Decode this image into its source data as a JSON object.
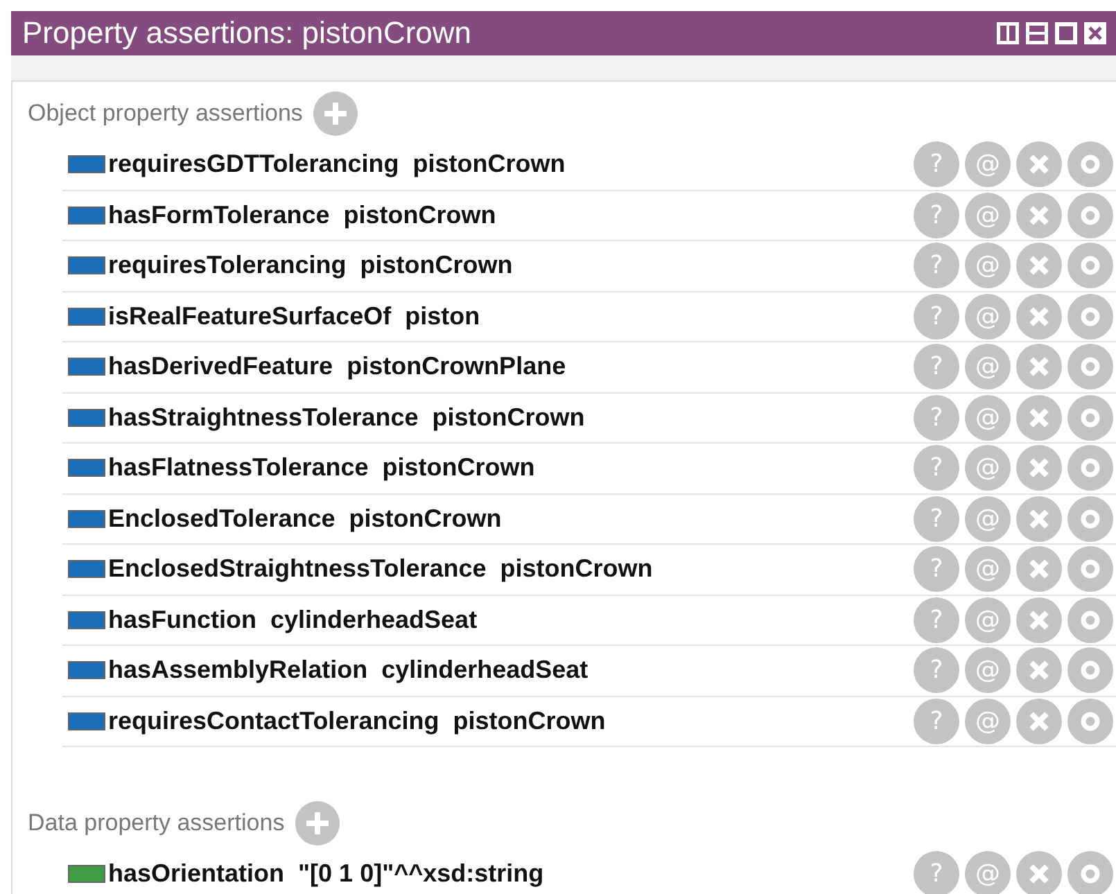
{
  "window": {
    "title": "Property assertions: pistonCrown"
  },
  "sections": [
    {
      "title": "Object property assertions",
      "color": "#1a6fb8",
      "rows": [
        {
          "property": "requiresGDTTolerancing",
          "value": "pistonCrown",
          "actions": [
            "?",
            "@"
          ]
        },
        {
          "property": "hasFormTolerance",
          "value": "pistonCrown",
          "actions": [
            "?",
            "@"
          ]
        },
        {
          "property": "requiresTolerancing",
          "value": "pistonCrown",
          "actions": [
            "?",
            "@"
          ]
        },
        {
          "property": "isRealFeatureSurfaceOf",
          "value": "piston",
          "actions": [
            "?",
            "@"
          ]
        },
        {
          "property": "hasDerivedFeature",
          "value": "pistonCrownPlane",
          "actions": [
            "?",
            "@"
          ]
        },
        {
          "property": "hasStraightnessTolerance",
          "value": "pistonCrown",
          "actions": [
            "?",
            "@"
          ]
        },
        {
          "property": "hasFlatnessTolerance",
          "value": "pistonCrown",
          "actions": [
            "?",
            "@"
          ]
        },
        {
          "property": "EnclosedTolerance",
          "value": "pistonCrown",
          "actions": [
            "?",
            "@"
          ]
        },
        {
          "property": "EnclosedStraightnessTolerance",
          "value": "pistonCrown",
          "actions": [
            "?",
            "@"
          ]
        },
        {
          "property": "hasFunction",
          "value": "cylinderheadSeat",
          "actions": [
            "?",
            "@"
          ]
        },
        {
          "property": "hasAssemblyRelation",
          "value": "cylinderheadSeat",
          "actions": [
            "?",
            "@"
          ]
        },
        {
          "property": "requiresContactTolerancing",
          "value": "pistonCrown",
          "actions": [
            "?",
            "@"
          ]
        }
      ]
    },
    {
      "title": "Data property assertions",
      "color": "#3f9c43",
      "rows": [
        {
          "property": "hasOrientation",
          "value": "\"[0 1 0]\"^^xsd:string",
          "actions": [
            "?",
            "@"
          ]
        }
      ]
    }
  ]
}
